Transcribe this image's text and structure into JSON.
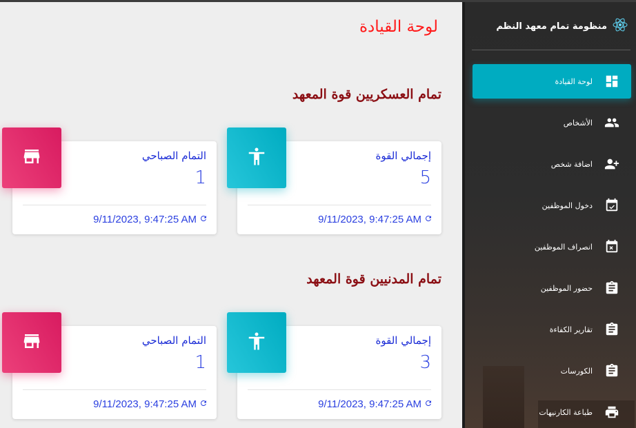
{
  "page": {
    "title": "لوحة القيادة"
  },
  "sections": [
    {
      "title": "تمام العسكريين قوة المعهد",
      "cards": [
        {
          "label": "إجمالي القوة",
          "value": "5",
          "timestamp": "9/11/2023, 9:47:25 AM",
          "icon": "accessibility-icon",
          "color": "#00acc1"
        },
        {
          "label": "التمام الصباحي",
          "value": "1",
          "timestamp": "9/11/2023, 9:47:25 AM",
          "icon": "store-icon",
          "color": "#e91e63"
        }
      ]
    },
    {
      "title": "تمام المدنيين قوة المعهد",
      "cards": [
        {
          "label": "إجمالي القوة",
          "value": "3",
          "timestamp": "9/11/2023, 9:47:25 AM",
          "icon": "accessibility-icon",
          "color": "#00acc1"
        },
        {
          "label": "التمام الصباحي",
          "value": "1",
          "timestamp": "9/11/2023, 9:47:25 AM",
          "icon": "store-icon",
          "color": "#e91e63"
        }
      ]
    }
  ],
  "sidebar": {
    "brand": "منظومة تمام معهد النظم",
    "brand_icon": "react-logo-icon",
    "items": [
      {
        "label": "لوحة القيادة",
        "icon": "dashboard-icon",
        "active": true
      },
      {
        "label": "الأشخاص",
        "icon": "people-icon"
      },
      {
        "label": "اضافة شخص",
        "icon": "add-person-icon"
      },
      {
        "label": "دخول الموظفين",
        "icon": "calendar-check-icon"
      },
      {
        "label": "انصراف الموظفين",
        "icon": "calendar-x-icon"
      },
      {
        "label": "حضور الموظفين",
        "icon": "clipboard-icon"
      },
      {
        "label": "تقارير الكفاءة",
        "icon": "clipboard-icon"
      },
      {
        "label": "الكورسات",
        "icon": "clipboard-icon"
      },
      {
        "label": "طباعة الكارنيهات",
        "icon": "print-icon"
      }
    ]
  }
}
